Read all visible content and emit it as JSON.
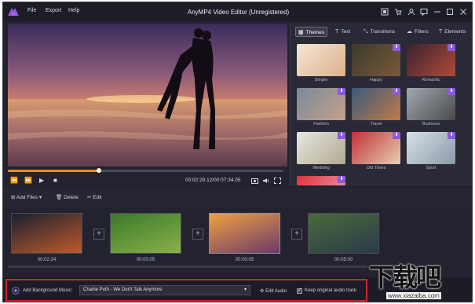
{
  "window": {
    "title": "AnyMP4 Video Editor (Unregistered)",
    "menus": [
      "File",
      "Export",
      "Help"
    ],
    "title_icons": [
      "register-icon",
      "cart-icon",
      "user-icon",
      "feedback-icon",
      "minimize-icon",
      "maximize-icon",
      "close-icon"
    ]
  },
  "player": {
    "time": "00:02:29.12/00:07:34.05",
    "progress": 0.33,
    "controls": [
      "rewind-icon",
      "fast-forward-icon",
      "play-icon",
      "stop-icon"
    ],
    "right_controls": [
      "snapshot-icon",
      "volume-icon",
      "fullscreen-icon"
    ]
  },
  "tabs": [
    {
      "label": "Themes",
      "icon": "themes-icon"
    },
    {
      "label": "Text",
      "icon": "text-icon"
    },
    {
      "label": "Transitions",
      "icon": "transitions-icon"
    },
    {
      "label": "Filters",
      "icon": "filters-icon"
    },
    {
      "label": "Elements",
      "icon": "elements-icon"
    }
  ],
  "themes": [
    {
      "label": "Simple",
      "colors": [
        "#f2e6d6",
        "#e0b08a"
      ],
      "download": false
    },
    {
      "label": "Happy",
      "colors": [
        "#3a3a2a",
        "#7a5a3a"
      ],
      "download": true
    },
    {
      "label": "Romantic",
      "colors": [
        "#3a2230",
        "#b04a3a"
      ],
      "download": true
    },
    {
      "label": "Fashion",
      "colors": [
        "#7a8a9a",
        "#c4a08a"
      ],
      "download": true
    },
    {
      "label": "Travel",
      "colors": [
        "#3a5a7a",
        "#c07a4a"
      ],
      "download": true
    },
    {
      "label": "Business",
      "colors": [
        "#a0a8b0",
        "#4a4a4a"
      ],
      "download": true
    },
    {
      "label": "Wedding",
      "colors": [
        "#e8e8e0",
        "#b0a890"
      ],
      "download": true
    },
    {
      "label": "Old Times",
      "colors": [
        "#c0303a",
        "#e8d0b0"
      ],
      "download": true
    },
    {
      "label": "Sport",
      "colors": [
        "#d8e0e8",
        "#8a9aa8"
      ],
      "download": true
    },
    {
      "label": "",
      "colors": [
        "#e0303a",
        "#e88a9a"
      ],
      "download": true
    }
  ],
  "toolbar": {
    "add_files": "Add Files",
    "delete": "Delete",
    "edit": "Edit"
  },
  "clips": [
    {
      "duration": "00:02:24",
      "colors": [
        "#1a2030",
        "#c05a2a"
      ],
      "selected": false
    },
    {
      "duration": "00:00:05",
      "colors": [
        "#3a7a2a",
        "#8ab04a"
      ],
      "selected": false
    },
    {
      "duration": "00:00:05",
      "colors": [
        "#f0a040",
        "#6a3a6a"
      ],
      "selected": true
    },
    {
      "duration": "00:05:00",
      "colors": [
        "#4a6a3a",
        "#2a3a4a"
      ],
      "selected": false
    }
  ],
  "bottom": {
    "add_music_label": "Add Background Music:",
    "music_value": "Charlie Puth - We Don't Talk Anymore",
    "edit_audio": "Edit Audio",
    "keep_original": "Keep original audio track",
    "keep_checked": true
  },
  "watermark": {
    "text": "下载吧",
    "url": "www.xiazaiba.com"
  }
}
